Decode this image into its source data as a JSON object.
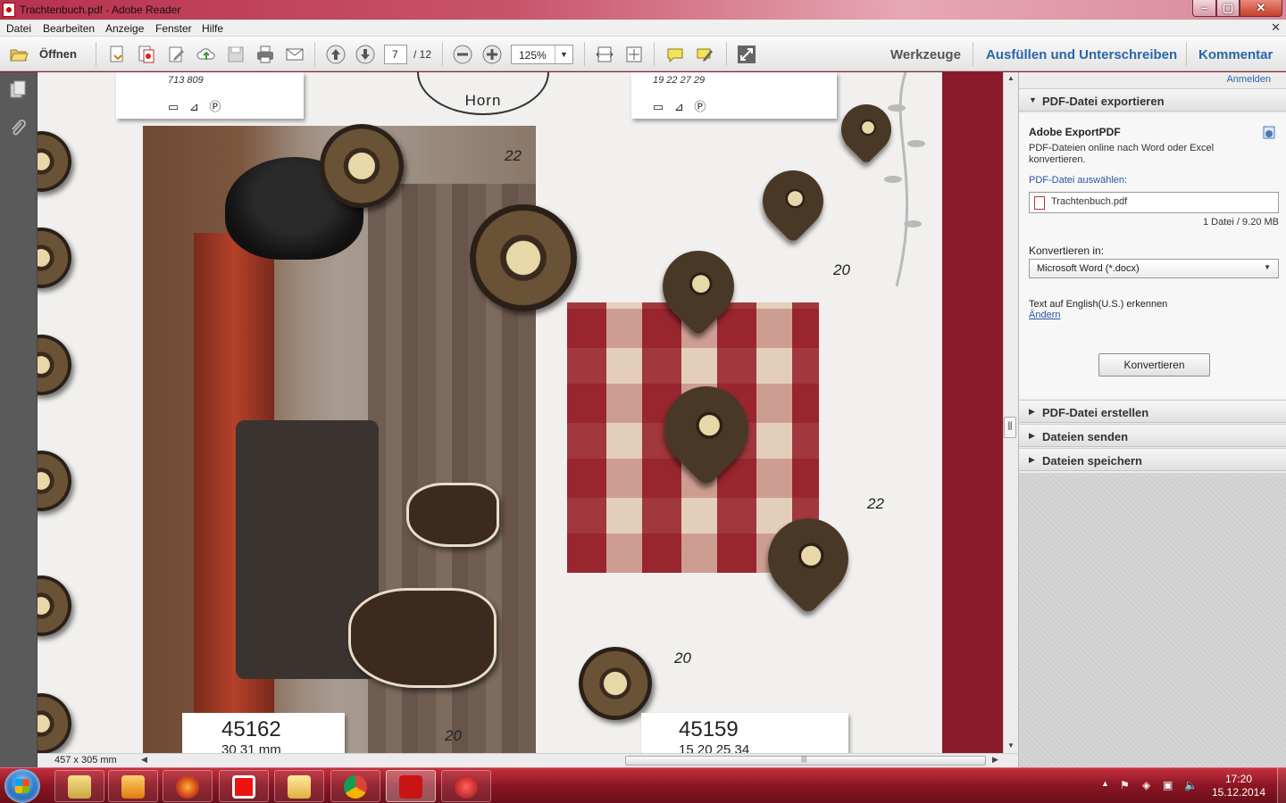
{
  "window": {
    "title": "Trachtenbuch.pdf - Adobe Reader"
  },
  "menu": [
    "Datei",
    "Bearbeiten",
    "Anzeige",
    "Fenster",
    "Hilfe"
  ],
  "toolbar": {
    "open_label": "Öffnen",
    "page_current": "7",
    "page_total": "/ 12",
    "zoom": "125%",
    "tools_label": "Werkzeuge",
    "fill_sign_label": "Ausfüllen und Unterschreiben",
    "comment_label": "Kommentar"
  },
  "document": {
    "horn_label": "Horn",
    "care_left_nums": "713   809",
    "care_right_nums": "19    22    27    29",
    "care_symbols": "▭ ⊿ Ⓟ",
    "sizes": [
      "22",
      "20",
      "22",
      "20",
      "20"
    ],
    "articles": [
      {
        "number": "45162",
        "mm": "30   31 mm"
      },
      {
        "number": "45159",
        "mm": "15   20   25   34"
      }
    ],
    "page_dimensions": "457 x 305 mm"
  },
  "rightpane": {
    "signin": "Anmelden",
    "export_section": "PDF-Datei exportieren",
    "exportpdf_title": "Adobe ExportPDF",
    "exportpdf_desc": "PDF-Dateien online nach Word oder Excel konvertieren.",
    "select_file_label": "PDF-Datei auswählen:",
    "file_name": "Trachtenbuch.pdf",
    "file_count": "1 Datei / 9.20 MB",
    "convert_to_label": "Konvertieren in:",
    "convert_to_value": "Microsoft Word (*.docx)",
    "ocr_text": "Text auf English(U.S.) erkennen",
    "change_link": "Ändern",
    "convert_button": "Konvertieren",
    "create_section": "PDF-Datei erstellen",
    "send_section": "Dateien senden",
    "save_section": "Dateien speichern"
  },
  "taskbar": {
    "time": "17:20",
    "date": "15.12.2014"
  },
  "colors": {
    "accent_link": "#2a66a8",
    "doc_background": "#8a1a2a",
    "taskbar": "#8a1622"
  }
}
